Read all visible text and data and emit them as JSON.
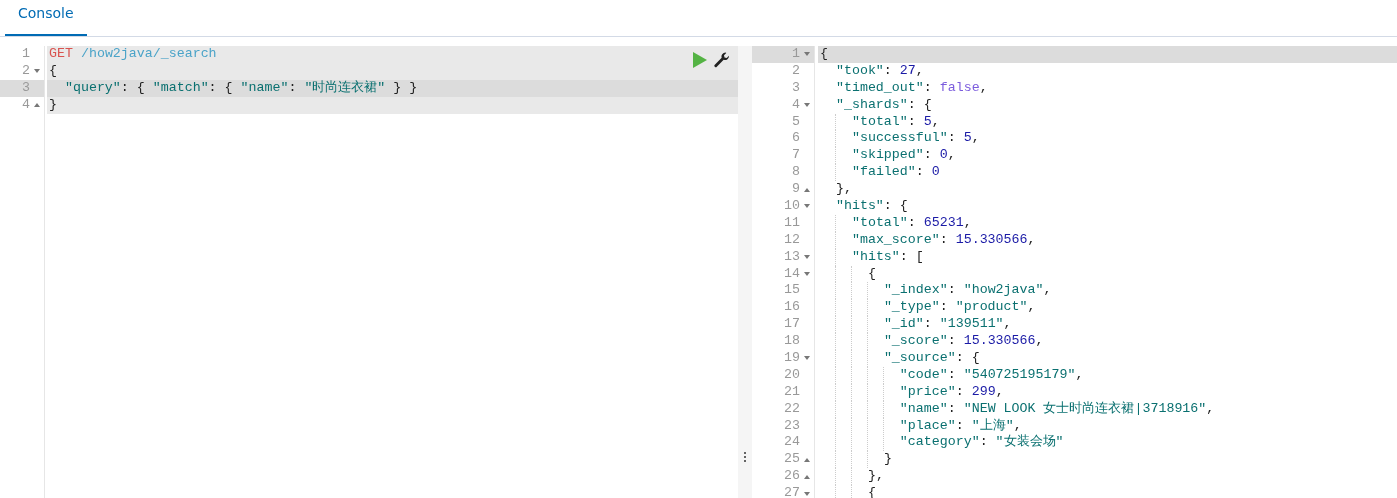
{
  "tabs": [
    {
      "label": "Console",
      "selected": true
    }
  ],
  "request_editor": {
    "lines": [
      {
        "number": "1",
        "fold_start": false,
        "fold_end": false,
        "in_request": true,
        "active": false,
        "tokens": [
          {
            "kind": "method",
            "text": "GET"
          },
          {
            "kind": "url",
            "text": "/how2java/_search"
          }
        ]
      },
      {
        "number": "2",
        "fold_start": true,
        "fold_end": false,
        "in_request": true,
        "active": false,
        "tokens": [
          {
            "kind": "punct",
            "text": "{"
          }
        ]
      },
      {
        "number": "3",
        "fold_start": false,
        "fold_end": false,
        "in_request": true,
        "active": true,
        "tokens": [
          {
            "kind": "key",
            "text": "\"query\""
          },
          {
            "kind": "punct",
            "text": ": { "
          },
          {
            "kind": "key",
            "text": "\"match\""
          },
          {
            "kind": "punct",
            "text": ": { "
          },
          {
            "kind": "key",
            "text": "\"name\""
          },
          {
            "kind": "punct",
            "text": ": "
          },
          {
            "kind": "string",
            "text": "\"时尚连衣裙\""
          },
          {
            "kind": "punct",
            "text": " } }"
          }
        ]
      },
      {
        "number": "4",
        "fold_start": false,
        "fold_end": true,
        "in_request": true,
        "active": false,
        "tokens": [
          {
            "kind": "punct",
            "text": "}"
          }
        ]
      }
    ]
  },
  "response_viewer": {
    "lines": [
      {
        "number": "1",
        "fold_start": true,
        "fold_end": false,
        "active": true,
        "tokens": [
          {
            "kind": "punct",
            "text": "{"
          }
        ]
      },
      {
        "number": "2",
        "fold_start": false,
        "fold_end": false,
        "active": false,
        "tokens": [
          {
            "kind": "key",
            "text": "\"took\""
          },
          {
            "kind": "punct",
            "text": ": "
          },
          {
            "kind": "number",
            "text": "27"
          },
          {
            "kind": "punct",
            "text": ","
          }
        ]
      },
      {
        "number": "3",
        "fold_start": false,
        "fold_end": false,
        "active": false,
        "tokens": [
          {
            "kind": "key",
            "text": "\"timed_out\""
          },
          {
            "kind": "punct",
            "text": ": "
          },
          {
            "kind": "boolean",
            "text": "false"
          },
          {
            "kind": "punct",
            "text": ","
          }
        ]
      },
      {
        "number": "4",
        "fold_start": true,
        "fold_end": false,
        "active": false,
        "tokens": [
          {
            "kind": "key",
            "text": "\"_shards\""
          },
          {
            "kind": "punct",
            "text": ": {"
          }
        ]
      },
      {
        "number": "5",
        "fold_start": false,
        "fold_end": false,
        "active": false,
        "tokens": [
          {
            "kind": "key",
            "text": "\"total\""
          },
          {
            "kind": "punct",
            "text": ": "
          },
          {
            "kind": "number",
            "text": "5"
          },
          {
            "kind": "punct",
            "text": ","
          }
        ]
      },
      {
        "number": "6",
        "fold_start": false,
        "fold_end": false,
        "active": false,
        "tokens": [
          {
            "kind": "key",
            "text": "\"successful\""
          },
          {
            "kind": "punct",
            "text": ": "
          },
          {
            "kind": "number",
            "text": "5"
          },
          {
            "kind": "punct",
            "text": ","
          }
        ]
      },
      {
        "number": "7",
        "fold_start": false,
        "fold_end": false,
        "active": false,
        "tokens": [
          {
            "kind": "key",
            "text": "\"skipped\""
          },
          {
            "kind": "punct",
            "text": ": "
          },
          {
            "kind": "number",
            "text": "0"
          },
          {
            "kind": "punct",
            "text": ","
          }
        ]
      },
      {
        "number": "8",
        "fold_start": false,
        "fold_end": false,
        "active": false,
        "tokens": [
          {
            "kind": "key",
            "text": "\"failed\""
          },
          {
            "kind": "punct",
            "text": ": "
          },
          {
            "kind": "number",
            "text": "0"
          }
        ]
      },
      {
        "number": "9",
        "fold_start": false,
        "fold_end": true,
        "active": false,
        "tokens": [
          {
            "kind": "punct",
            "text": "},"
          }
        ]
      },
      {
        "number": "10",
        "fold_start": true,
        "fold_end": false,
        "active": false,
        "tokens": [
          {
            "kind": "key",
            "text": "\"hits\""
          },
          {
            "kind": "punct",
            "text": ": {"
          }
        ]
      },
      {
        "number": "11",
        "fold_start": false,
        "fold_end": false,
        "active": false,
        "tokens": [
          {
            "kind": "key",
            "text": "\"total\""
          },
          {
            "kind": "punct",
            "text": ": "
          },
          {
            "kind": "number",
            "text": "65231"
          },
          {
            "kind": "punct",
            "text": ","
          }
        ]
      },
      {
        "number": "12",
        "fold_start": false,
        "fold_end": false,
        "active": false,
        "tokens": [
          {
            "kind": "key",
            "text": "\"max_score\""
          },
          {
            "kind": "punct",
            "text": ": "
          },
          {
            "kind": "number",
            "text": "15.330566"
          },
          {
            "kind": "punct",
            "text": ","
          }
        ]
      },
      {
        "number": "13",
        "fold_start": true,
        "fold_end": false,
        "active": false,
        "tokens": [
          {
            "kind": "key",
            "text": "\"hits\""
          },
          {
            "kind": "punct",
            "text": ": ["
          }
        ]
      },
      {
        "number": "14",
        "fold_start": true,
        "fold_end": false,
        "active": false,
        "tokens": [
          {
            "kind": "punct",
            "text": "{"
          }
        ]
      },
      {
        "number": "15",
        "fold_start": false,
        "fold_end": false,
        "active": false,
        "tokens": [
          {
            "kind": "key",
            "text": "\"_index\""
          },
          {
            "kind": "punct",
            "text": ": "
          },
          {
            "kind": "string",
            "text": "\"how2java\""
          },
          {
            "kind": "punct",
            "text": ","
          }
        ]
      },
      {
        "number": "16",
        "fold_start": false,
        "fold_end": false,
        "active": false,
        "tokens": [
          {
            "kind": "key",
            "text": "\"_type\""
          },
          {
            "kind": "punct",
            "text": ": "
          },
          {
            "kind": "string",
            "text": "\"product\""
          },
          {
            "kind": "punct",
            "text": ","
          }
        ]
      },
      {
        "number": "17",
        "fold_start": false,
        "fold_end": false,
        "active": false,
        "tokens": [
          {
            "kind": "key",
            "text": "\"_id\""
          },
          {
            "kind": "punct",
            "text": ": "
          },
          {
            "kind": "string",
            "text": "\"139511\""
          },
          {
            "kind": "punct",
            "text": ","
          }
        ]
      },
      {
        "number": "18",
        "fold_start": false,
        "fold_end": false,
        "active": false,
        "tokens": [
          {
            "kind": "key",
            "text": "\"_score\""
          },
          {
            "kind": "punct",
            "text": ": "
          },
          {
            "kind": "number",
            "text": "15.330566"
          },
          {
            "kind": "punct",
            "text": ","
          }
        ]
      },
      {
        "number": "19",
        "fold_start": true,
        "fold_end": false,
        "active": false,
        "tokens": [
          {
            "kind": "key",
            "text": "\"_source\""
          },
          {
            "kind": "punct",
            "text": ": {"
          }
        ]
      },
      {
        "number": "20",
        "fold_start": false,
        "fold_end": false,
        "active": false,
        "tokens": [
          {
            "kind": "key",
            "text": "\"code\""
          },
          {
            "kind": "punct",
            "text": ": "
          },
          {
            "kind": "string",
            "text": "\"540725195179\""
          },
          {
            "kind": "punct",
            "text": ","
          }
        ]
      },
      {
        "number": "21",
        "fold_start": false,
        "fold_end": false,
        "active": false,
        "tokens": [
          {
            "kind": "key",
            "text": "\"price\""
          },
          {
            "kind": "punct",
            "text": ": "
          },
          {
            "kind": "number",
            "text": "299"
          },
          {
            "kind": "punct",
            "text": ","
          }
        ]
      },
      {
        "number": "22",
        "fold_start": false,
        "fold_end": false,
        "active": false,
        "tokens": [
          {
            "kind": "key",
            "text": "\"name\""
          },
          {
            "kind": "punct",
            "text": ": "
          },
          {
            "kind": "string",
            "text": "\"NEW LOOK 女士时尚连衣裙|3718916\""
          },
          {
            "kind": "punct",
            "text": ","
          }
        ]
      },
      {
        "number": "23",
        "fold_start": false,
        "fold_end": false,
        "active": false,
        "tokens": [
          {
            "kind": "key",
            "text": "\"place\""
          },
          {
            "kind": "punct",
            "text": ": "
          },
          {
            "kind": "string",
            "text": "\"上海\""
          },
          {
            "kind": "punct",
            "text": ","
          }
        ]
      },
      {
        "number": "24",
        "fold_start": false,
        "fold_end": false,
        "active": false,
        "tokens": [
          {
            "kind": "key",
            "text": "\"category\""
          },
          {
            "kind": "punct",
            "text": ": "
          },
          {
            "kind": "string",
            "text": "\"女装会场\""
          }
        ]
      },
      {
        "number": "25",
        "fold_start": false,
        "fold_end": true,
        "active": false,
        "tokens": [
          {
            "kind": "punct",
            "text": "}"
          }
        ]
      },
      {
        "number": "26",
        "fold_start": false,
        "fold_end": true,
        "active": false,
        "tokens": [
          {
            "kind": "punct",
            "text": "},"
          }
        ]
      },
      {
        "number": "27",
        "fold_start": true,
        "fold_end": false,
        "active": false,
        "tokens": [
          {
            "kind": "punct",
            "text": "{"
          }
        ]
      }
    ]
  }
}
